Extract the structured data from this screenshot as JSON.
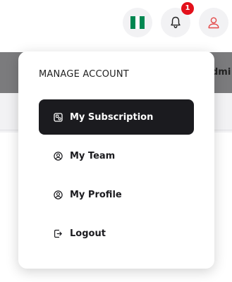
{
  "header": {
    "flag_icon": "nigeria-flag-icon",
    "bell_icon": "bell-icon",
    "notification_count": "1",
    "user_icon": "user-icon",
    "background_label": "dmi"
  },
  "dropdown": {
    "title": "MANAGE ACCOUNT",
    "items": [
      {
        "label": "My Subscription",
        "icon": "subscription-icon",
        "active": true
      },
      {
        "label": "My Team",
        "icon": "user-circle-icon",
        "active": false
      },
      {
        "label": "My Profile",
        "icon": "user-circle-icon",
        "active": false
      },
      {
        "label": "Logout",
        "icon": "logout-icon",
        "active": false
      }
    ]
  },
  "colors": {
    "active_bg": "#1b1b1f",
    "badge_red": "#e3101b",
    "flag_green": "#008751",
    "user_icon_red": "#e44a4a",
    "strip_gray": "#7b7b7d"
  }
}
